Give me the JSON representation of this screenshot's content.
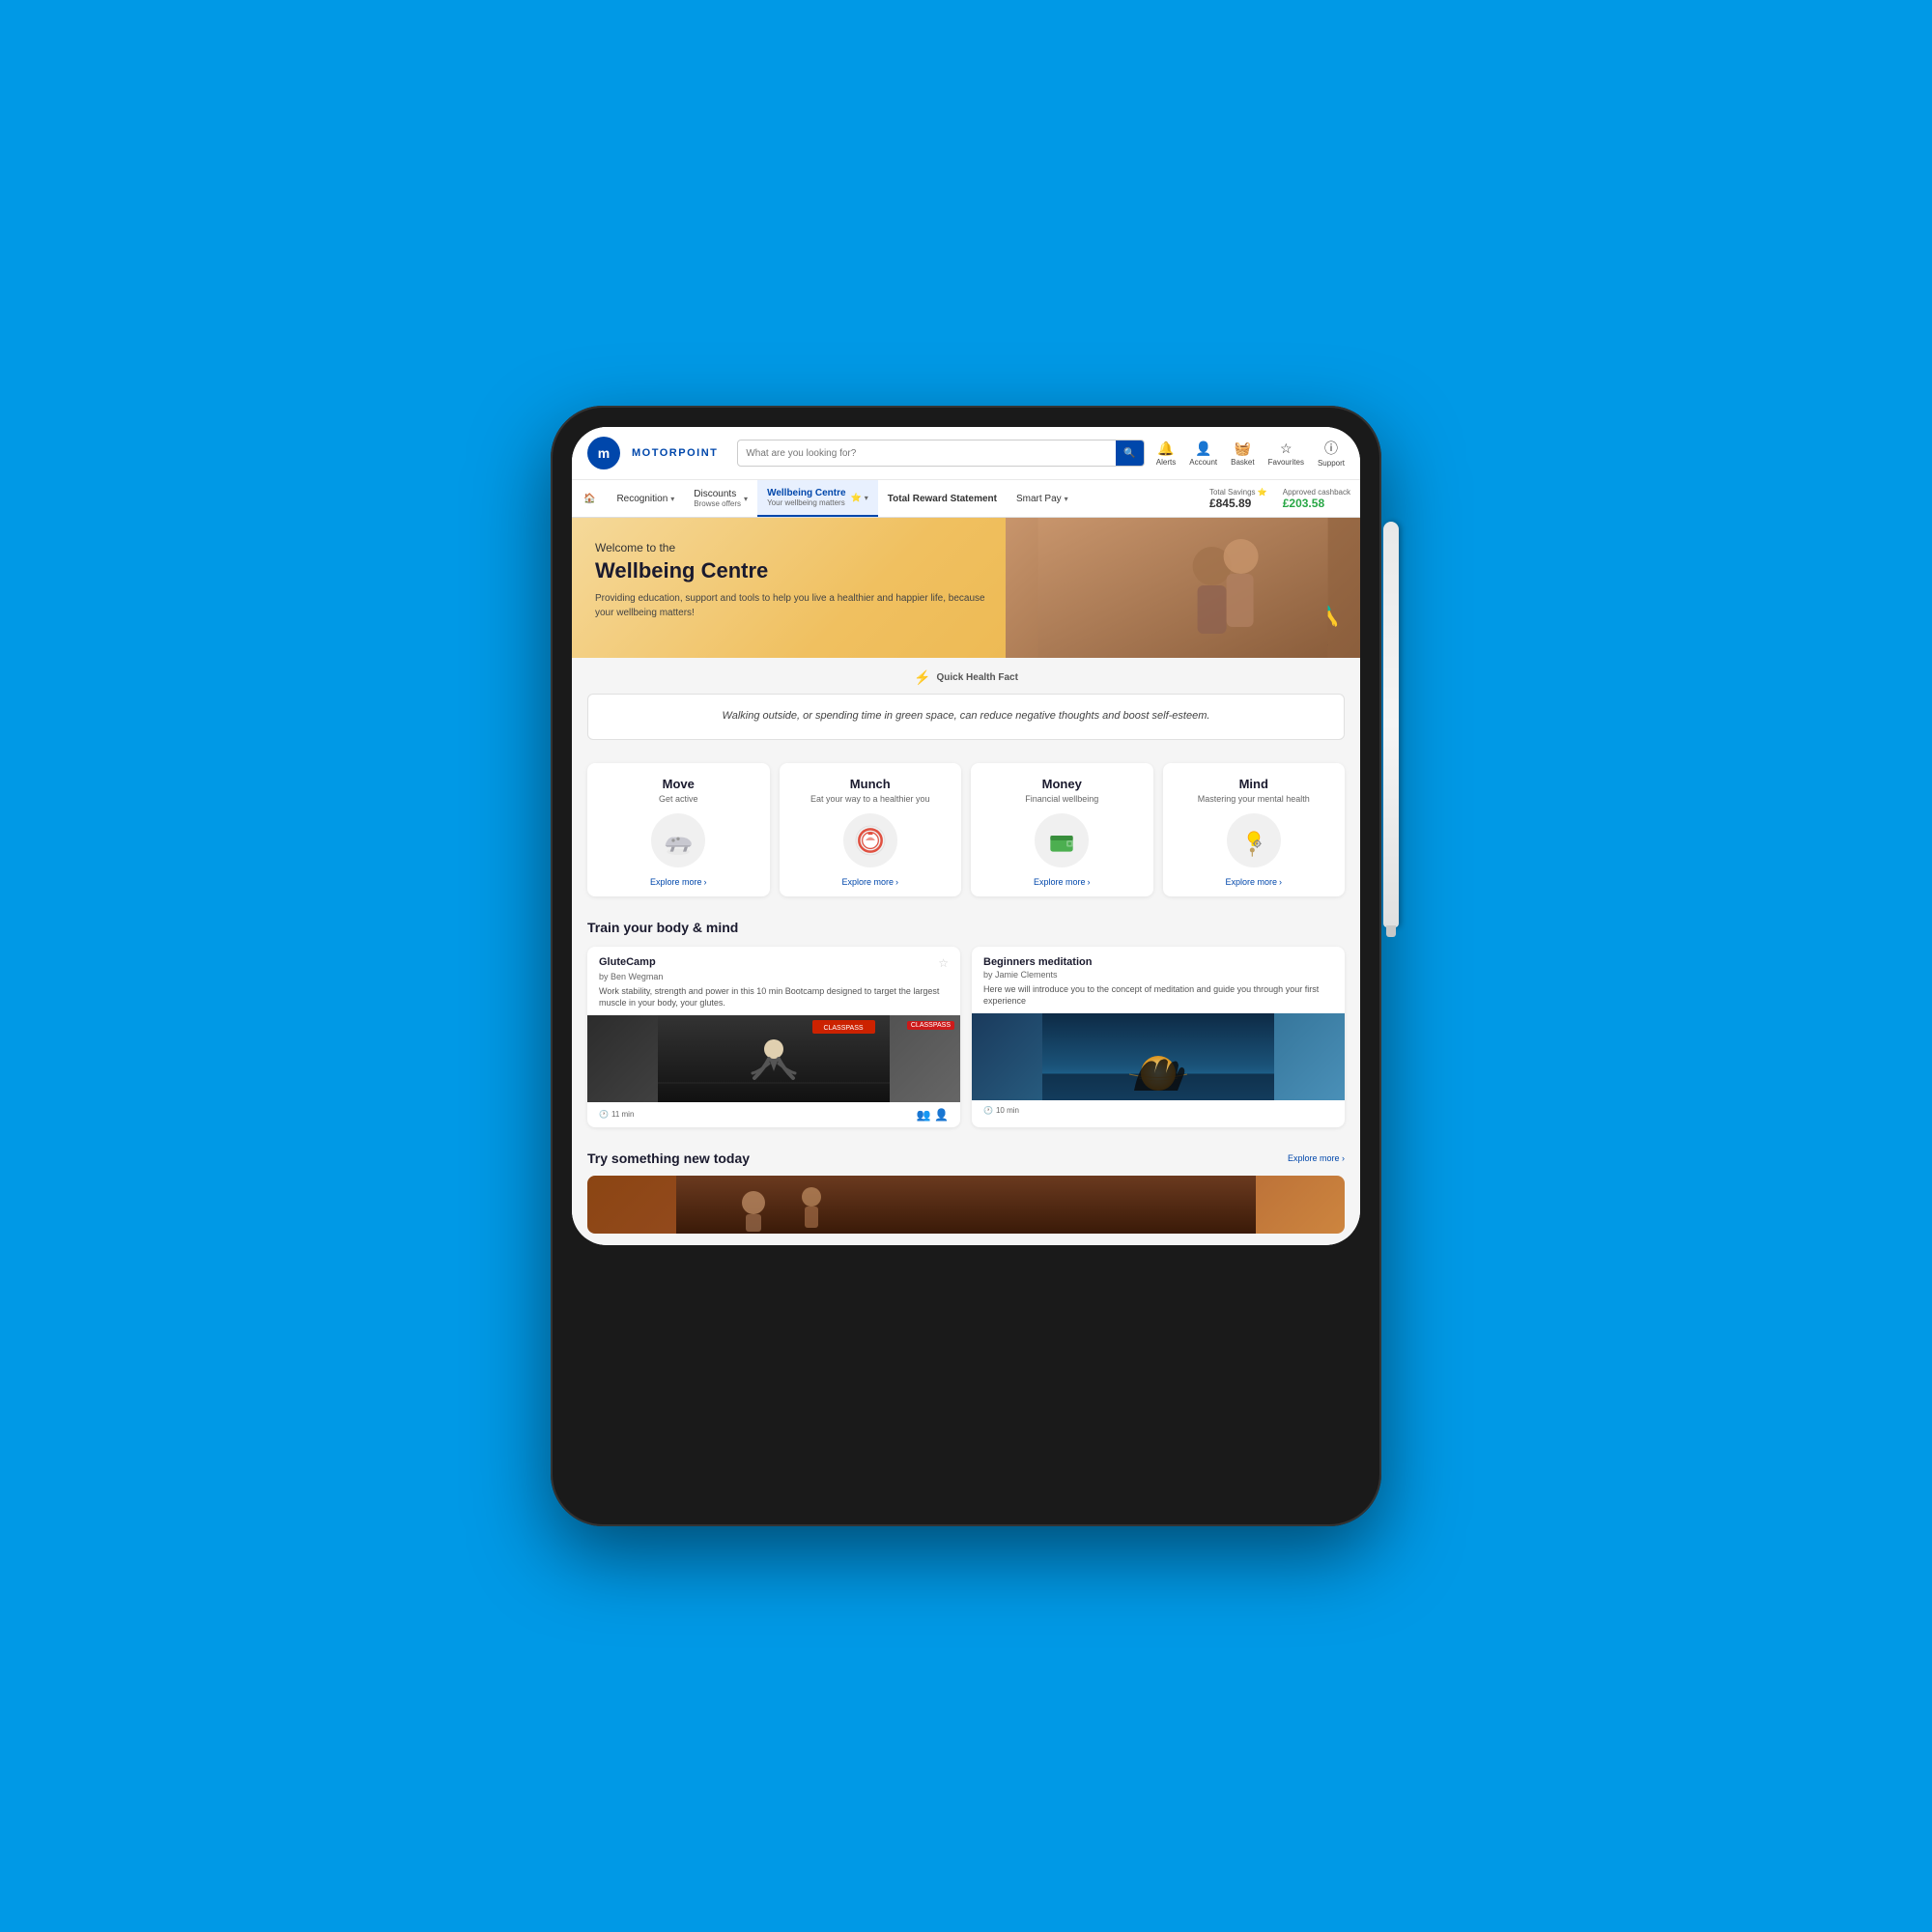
{
  "device": {
    "type": "tablet"
  },
  "topnav": {
    "brand": "MOTORPOINT",
    "brand_letter": "m",
    "search_placeholder": "What are you looking for?",
    "icons": [
      {
        "id": "alerts",
        "symbol": "🔔",
        "label": "Alerts"
      },
      {
        "id": "account",
        "symbol": "👤",
        "label": "Account"
      },
      {
        "id": "basket",
        "symbol": "🧺",
        "label": "Basket"
      },
      {
        "id": "favourites",
        "symbol": "☆",
        "label": "Favourites"
      },
      {
        "id": "support",
        "symbol": "⓪",
        "label": "Support"
      }
    ]
  },
  "secondnav": {
    "items": [
      {
        "id": "home",
        "label": "🏠",
        "type": "home"
      },
      {
        "id": "recognition",
        "label": "Recognition",
        "has_dropdown": true
      },
      {
        "id": "discounts",
        "label": "Discounts",
        "sublabel": "Browse offers",
        "has_dropdown": true
      },
      {
        "id": "wellbeing",
        "label": "Wellbeing Centre",
        "sublabel": "Your wellbeing matters",
        "has_dropdown": true,
        "active": true
      },
      {
        "id": "total-reward",
        "label": "Total Reward Statement"
      },
      {
        "id": "smart-pay",
        "label": "Smart Pay",
        "has_dropdown": true
      }
    ],
    "total_savings_label": "Total Savings",
    "total_savings_value": "£845.89",
    "total_savings_icon": "⭐",
    "approved_cashback_label": "Approved cashback",
    "approved_cashback_value": "£203.58",
    "approved_cashback_icon": "ℹ️"
  },
  "hero": {
    "welcome_text": "Welcome to the",
    "title": "Wellbeing Centre",
    "subtitle": "Providing education, support and tools to help you live a healthier and happier life, because your wellbeing matters!"
  },
  "health_fact": {
    "section_label": "Quick Health Fact",
    "icon": "✦",
    "text": "Walking outside, or spending time in green space, can reduce negative thoughts and boost self-esteem."
  },
  "categories": [
    {
      "id": "move",
      "title": "Move",
      "subtitle": "Get active",
      "icon": "👟",
      "explore_label": "Explore more"
    },
    {
      "id": "munch",
      "title": "Munch",
      "subtitle": "Eat your way to a healthier you",
      "icon": "🍽️",
      "explore_label": "Explore more"
    },
    {
      "id": "money",
      "title": "Money",
      "subtitle": "Financial wellbeing",
      "icon": "💰",
      "explore_label": "Explore more"
    },
    {
      "id": "mind",
      "title": "Mind",
      "subtitle": "Mastering your mental health",
      "icon": "🧠",
      "explore_label": "Explore more"
    }
  ],
  "training": {
    "section_title": "Train your body & mind",
    "items": [
      {
        "id": "glute-camp",
        "title": "GluteCamp",
        "author": "by Ben Wegman",
        "description": "Work stability, strength and power in this 10 min Bootcamp designed to target the largest muscle in your body, your glutes.",
        "duration": "11 min",
        "type": "gym"
      },
      {
        "id": "beginners-meditation",
        "title": "Beginners meditation",
        "author": "by Jamie Clements",
        "description": "Here we will introduce you to the concept of meditation and guide you through your first experience",
        "duration": "10 min",
        "type": "meditation"
      }
    ]
  },
  "try_new": {
    "section_title": "Try something new today",
    "explore_label": "Explore more ›"
  }
}
